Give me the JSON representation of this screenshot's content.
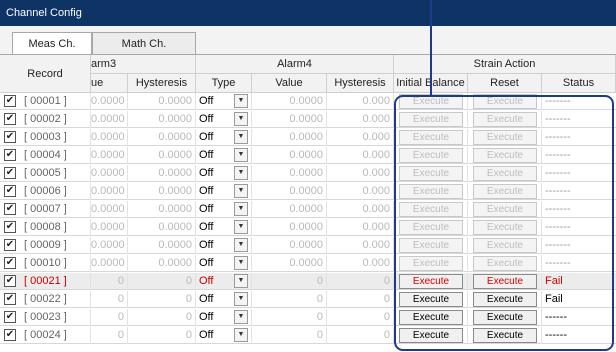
{
  "window": {
    "title": "Channel Config"
  },
  "tabs": [
    {
      "label": "Meas Ch."
    },
    {
      "label": "Math Ch."
    }
  ],
  "header": {
    "record": "Record",
    "alarm3": "arm3",
    "alarm4": "Alarm4",
    "strain_action": "Strain Action",
    "value_partial": "ue",
    "hysteresis": "Hysteresis",
    "type": "Type",
    "value": "Value",
    "initial_balance": "Initial Balance",
    "reset": "Reset",
    "status": "Status"
  },
  "rows": [
    {
      "record": "[ 00001 ]",
      "a3_value": "0.0000",
      "a3_hyst": "0.0000",
      "type": "Off",
      "a4_value": "0.0000",
      "a4_hyst": "0.000",
      "initial_balance": "Execute",
      "reset": "Execute",
      "status": "-------"
    },
    {
      "record": "[ 00002 ]",
      "a3_value": "0.0000",
      "a3_hyst": "0.0000",
      "type": "Off",
      "a4_value": "0.0000",
      "a4_hyst": "0.000",
      "initial_balance": "Execute",
      "reset": "Execute",
      "status": "-------"
    },
    {
      "record": "[ 00003 ]",
      "a3_value": "0.0000",
      "a3_hyst": "0.0000",
      "type": "Off",
      "a4_value": "0.0000",
      "a4_hyst": "0.000",
      "initial_balance": "Execute",
      "reset": "Execute",
      "status": "-------"
    },
    {
      "record": "[ 00004 ]",
      "a3_value": "0.0000",
      "a3_hyst": "0.0000",
      "type": "Off",
      "a4_value": "0.0000",
      "a4_hyst": "0.000",
      "initial_balance": "Execute",
      "reset": "Execute",
      "status": "-------"
    },
    {
      "record": "[ 00005 ]",
      "a3_value": "0.0000",
      "a3_hyst": "0.0000",
      "type": "Off",
      "a4_value": "0.0000",
      "a4_hyst": "0.000",
      "initial_balance": "Execute",
      "reset": "Execute",
      "status": "-------"
    },
    {
      "record": "[ 00006 ]",
      "a3_value": "0.0000",
      "a3_hyst": "0.0000",
      "type": "Off",
      "a4_value": "0.0000",
      "a4_hyst": "0.000",
      "initial_balance": "Execute",
      "reset": "Execute",
      "status": "-------"
    },
    {
      "record": "[ 00007 ]",
      "a3_value": "0.0000",
      "a3_hyst": "0.0000",
      "type": "Off",
      "a4_value": "0.0000",
      "a4_hyst": "0.000",
      "initial_balance": "Execute",
      "reset": "Execute",
      "status": "-------"
    },
    {
      "record": "[ 00008 ]",
      "a3_value": "0.0000",
      "a3_hyst": "0.0000",
      "type": "Off",
      "a4_value": "0.0000",
      "a4_hyst": "0.000",
      "initial_balance": "Execute",
      "reset": "Execute",
      "status": "-------"
    },
    {
      "record": "[ 00009 ]",
      "a3_value": "0.0000",
      "a3_hyst": "0.0000",
      "type": "Off",
      "a4_value": "0.0000",
      "a4_hyst": "0.000",
      "initial_balance": "Execute",
      "reset": "Execute",
      "status": "-------"
    },
    {
      "record": "[ 00010 ]",
      "a3_value": "0.0000",
      "a3_hyst": "0.0000",
      "type": "Off",
      "a4_value": "0.0000",
      "a4_hyst": "0.000",
      "initial_balance": "Execute",
      "reset": "Execute",
      "status": "-------"
    },
    {
      "record": "[ 00021 ]",
      "a3_value": "0",
      "a3_hyst": "0",
      "type": "Off",
      "a4_value": "0",
      "a4_hyst": "0",
      "initial_balance": "Execute",
      "reset": "Execute",
      "status": "Fail"
    },
    {
      "record": "[ 00022 ]",
      "a3_value": "0",
      "a3_hyst": "0",
      "type": "Off",
      "a4_value": "0",
      "a4_hyst": "0",
      "initial_balance": "Execute",
      "reset": "Execute",
      "status": "Fail"
    },
    {
      "record": "[ 00023 ]",
      "a3_value": "0",
      "a3_hyst": "0",
      "type": "Off",
      "a4_value": "0",
      "a4_hyst": "0",
      "initial_balance": "Execute",
      "reset": "Execute",
      "status": "------"
    },
    {
      "record": "[ 00024 ]",
      "a3_value": "0",
      "a3_hyst": "0",
      "type": "Off",
      "a4_value": "0",
      "a4_hyst": "0",
      "initial_balance": "Execute",
      "reset": "Execute",
      "status": "------"
    }
  ],
  "icons": {
    "checkbox": "checkmark-icon",
    "dropdown": "chevron-down-icon"
  },
  "colors": {
    "titlebar": "#0e3466",
    "error_text": "#dd0000",
    "annotation": "#1e3a8a"
  }
}
